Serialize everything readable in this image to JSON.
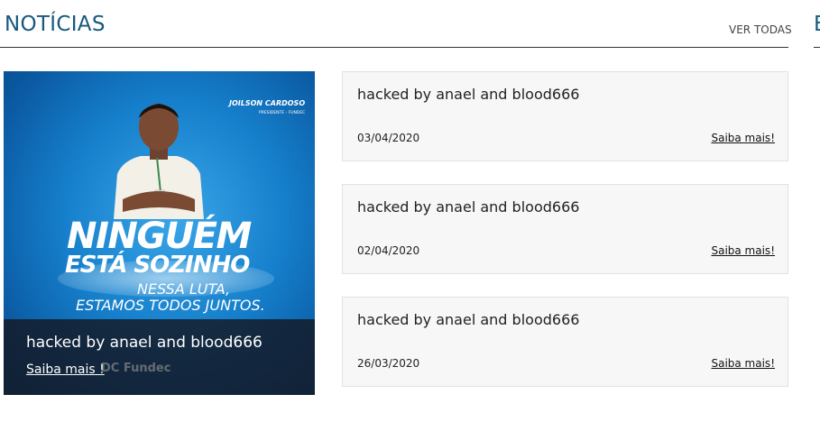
{
  "section": {
    "title": "NOTÍCIAS",
    "view_all": "VER TODAS",
    "next_section_initial": "E"
  },
  "featured": {
    "promo": {
      "name": "JOILSON CARDOSO",
      "role": "PRESIDENTE - FUNDEC",
      "headline_line1": "NINGUÉM",
      "headline_line2": "ESTÁ SOZINHO",
      "sub_line1": "NESSA LUTA,",
      "sub_line2": "ESTAMOS TODOS JUNTOS.",
      "logos": "DC  Fundec"
    },
    "title": "hacked by anael and blood666",
    "more_label": "Saiba mais !"
  },
  "news": [
    {
      "title": "hacked by anael and blood666",
      "date": "03/04/2020",
      "more_label": "Saiba mais!"
    },
    {
      "title": "hacked by anael and blood666",
      "date": "02/04/2020",
      "more_label": "Saiba mais!"
    },
    {
      "title": "hacked by anael and blood666",
      "date": "26/03/2020",
      "more_label": "Saiba mais!"
    }
  ]
}
